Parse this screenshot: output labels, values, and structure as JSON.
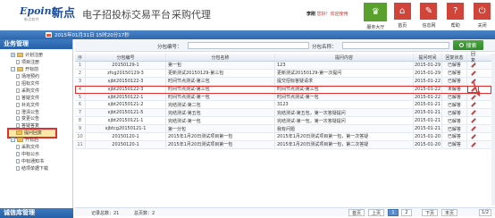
{
  "brand": {
    "logo_latin": "Epoint",
    "logo_cn": "新点",
    "logo_sub": "新点软件",
    "platform_title": "电子招投标交易平台",
    "module_title": "采购代理"
  },
  "user": {
    "name": "李刚",
    "welcome": "您好！欢迎使用"
  },
  "nav": [
    {
      "label": "服务大厅",
      "icon": "service-hall-icon",
      "color": "#5aa02c"
    },
    {
      "label": "首页",
      "icon": "home-icon",
      "color": "#d0443a"
    },
    {
      "label": "信息网",
      "icon": "info-net-icon",
      "color": "#d0443a"
    },
    {
      "label": "帮助",
      "icon": "help-icon",
      "color": "#d0443a"
    },
    {
      "label": "关闭",
      "icon": "power-icon",
      "color": "#d0443a"
    }
  ],
  "date_text": "2015年01月31日 15时20分17秒",
  "sidebar": {
    "title": "业务管理",
    "footer": "诚信库管理",
    "items": [
      {
        "label": "计划注册",
        "type": "folder",
        "level": 0,
        "expander": "+"
      },
      {
        "label": "项目注册",
        "type": "doc",
        "level": 1
      },
      {
        "label": "开标前",
        "type": "folder",
        "level": 0,
        "expander": "-"
      },
      {
        "label": "场地预约",
        "type": "doc",
        "level": 1
      },
      {
        "label": "招标文件",
        "type": "doc",
        "level": 1
      },
      {
        "label": "采购文件",
        "type": "doc",
        "level": 1
      },
      {
        "label": "答疑文件",
        "type": "doc",
        "level": 1
      },
      {
        "label": "补充文件",
        "type": "doc",
        "level": 1
      },
      {
        "label": "澄清公告",
        "type": "doc",
        "level": 1
      },
      {
        "label": "变更公告",
        "type": "doc",
        "level": 1
      },
      {
        "label": "答疑答复",
        "type": "doc",
        "level": 1
      },
      {
        "label": "提问回复",
        "type": "folder",
        "level": 1,
        "selected": true
      },
      {
        "label": "开标后",
        "type": "folder",
        "level": 0,
        "expander": "-"
      },
      {
        "label": "采购文件",
        "type": "doc",
        "level": 1
      },
      {
        "label": "中标公示",
        "type": "doc",
        "level": 1
      },
      {
        "label": "中标通知书",
        "type": "doc",
        "level": 1
      },
      {
        "label": "结项单据下载",
        "type": "doc",
        "level": 1
      }
    ]
  },
  "search": {
    "field1_label": "分包编号：",
    "field2_label": "分包名称：",
    "button_label": "搜索",
    "field1_value": "",
    "field2_value": ""
  },
  "grid": {
    "columns": [
      "序",
      "分包编号",
      "分包名称",
      "提问内容",
      "提问时间",
      "回复状态",
      "回复"
    ],
    "rows": [
      {
        "num": "1",
        "code": "20150129-1",
        "name": "第一包",
        "info": "123",
        "date": "2015-01-29",
        "status": "已解答"
      },
      {
        "num": "2",
        "code": "zfcg20150129-3",
        "name": "更新测试20150129-第三包",
        "info": "更新测试20150129-第一次提问",
        "date": "2015-01-29",
        "status": "已解答"
      },
      {
        "num": "3",
        "code": "xjbt20150122-3",
        "name": "时间节点测试-第三包",
        "info": "提交招标答疑请求",
        "date": "2015-01-22",
        "status": "已解答"
      },
      {
        "num": "4",
        "code": "xjbt20150122-3",
        "name": "时间节点测试-第三包",
        "info": "时间节点测试-第三包",
        "date": "2015-01-22",
        "status": "未解答",
        "highlight": true
      },
      {
        "num": "5",
        "code": "xjbt20150122-1",
        "name": "时间节点测试-第一包",
        "info": "时间节点测试-第一包",
        "date": "2015-01-22",
        "status": "已解答"
      },
      {
        "num": "6",
        "code": "xjbt20150121-2",
        "name": "完结测试-第二包",
        "info": "3123",
        "date": "2015-01-21",
        "status": "已解答"
      },
      {
        "num": "7",
        "code": "xjbt20150121-5",
        "name": "完结测试-第五包",
        "info": "完结测试-第五包，第一次答疑提问",
        "date": "2015-01-21",
        "status": "已解答"
      },
      {
        "num": "8",
        "code": "xjbt20150121-1",
        "name": "完结测试-第一包",
        "info": "完结测试-第一包，第一次答疑提问",
        "date": "2015-01-21",
        "status": "已解答"
      },
      {
        "num": "9",
        "code": "xjbtcg20150121-1",
        "name": "第一分包",
        "info": "我有问题",
        "date": "2015-01-21",
        "status": "已解答"
      },
      {
        "num": "10",
        "code": "20150120-1",
        "name": "2015年1月20日测试项目第一包",
        "info": "2015年1月20日测试项目第一包，第一次答疑",
        "date": "2015-01-20",
        "status": "已解答"
      },
      {
        "num": "11",
        "code": "20150120-1",
        "name": "2015年1月20日测试项目第一包",
        "info": "2015年1月20日测试项目第一包，第二次答疑",
        "date": "2015-01-20",
        "status": "已解答"
      }
    ]
  },
  "pager": {
    "total_label": "记录总数：21",
    "pages_label": "总页数：2",
    "first": "首页",
    "prev": "上页",
    "p1": "1",
    "p2": "2",
    "next": "下页",
    "last": "末页",
    "page_size": "1/2"
  }
}
